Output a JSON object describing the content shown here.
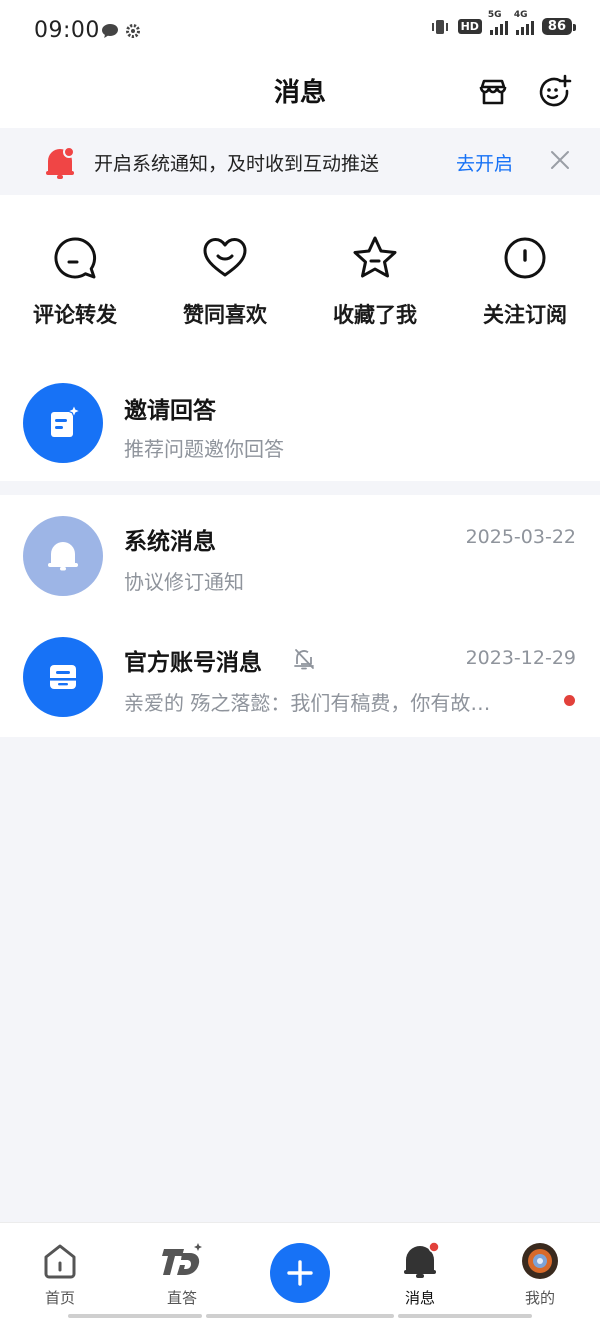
{
  "status_bar": {
    "time": "09:00",
    "network_hd": "HD",
    "net1": "5G",
    "net2": "4G",
    "battery": "86"
  },
  "header": {
    "title": "消息",
    "left_icon": "shop-icon",
    "right_icon": "add-friend-icon"
  },
  "notice": {
    "text": "开启系统通知，及时收到互动推送",
    "action": "去开启"
  },
  "quick_actions": [
    {
      "label": "评论转发",
      "icon": "comment-bubble-icon"
    },
    {
      "label": "赞同喜欢",
      "icon": "heart-smile-icon"
    },
    {
      "label": "收藏了我",
      "icon": "star-icon"
    },
    {
      "label": "关注订阅",
      "icon": "follow-icon"
    }
  ],
  "invite": {
    "title": "邀请回答",
    "subtitle": "推荐问题邀你回答"
  },
  "messages": [
    {
      "title": "系统消息",
      "subtitle": "协议修订通知",
      "date": "2025-03-22"
    },
    {
      "title": "官方账号消息",
      "subtitle": "亲爱的 殇之落懿：我们有稿费，你有故…",
      "date": "2023-12-29",
      "unread": true
    }
  ],
  "tabbar": [
    {
      "label": "首页"
    },
    {
      "label": "直答"
    },
    {
      "label": "消息",
      "active": true
    },
    {
      "label": "我的"
    }
  ],
  "colors": {
    "accent": "#1772f6",
    "badge": "#e2413b",
    "system_avatar": "#9db5e6"
  }
}
